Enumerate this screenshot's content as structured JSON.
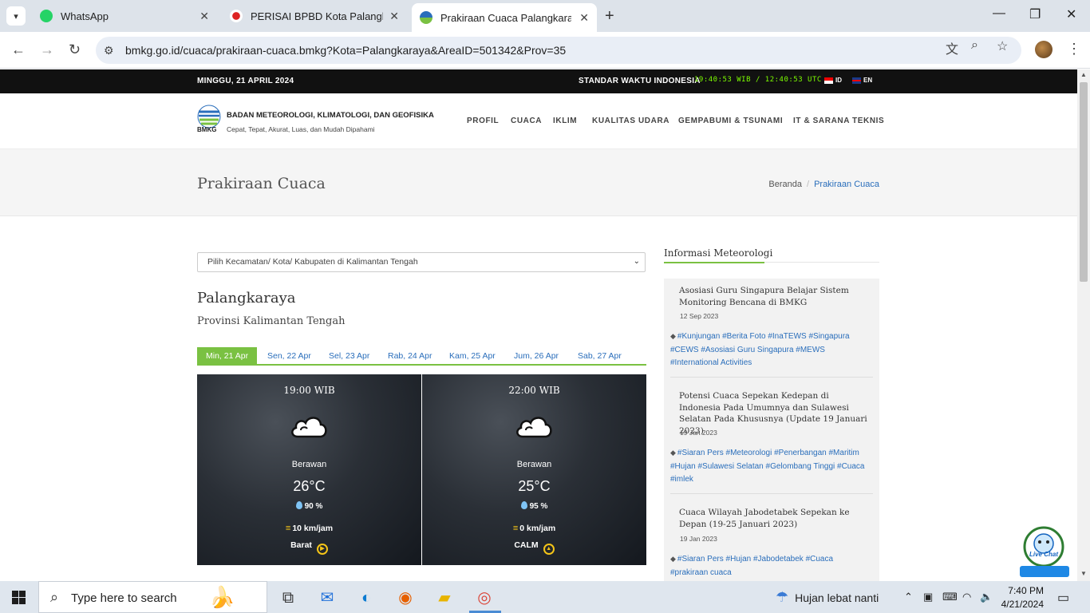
{
  "browser": {
    "tabs": [
      {
        "title": "WhatsApp"
      },
      {
        "title": "PERISAI BPBD Kota Palangka Ra"
      },
      {
        "title": "Prakiraan Cuaca Palangkaraya"
      }
    ],
    "url": "bmkg.go.id/cuaca/prakiraan-cuaca.bmkg?Kota=Palangkaraya&AreaID=501342&Prov=35"
  },
  "topbar": {
    "date": "MINGGU, 21 APRIL 2024",
    "standard_time_label": "STANDAR WAKTU INDONESIA",
    "clock": "19:40:53 WIB / 12:40:53 UTC",
    "lang_id": "ID",
    "lang_en": "EN"
  },
  "header": {
    "logo_text": "BMKG",
    "org_name": "BADAN METEOROLOGI, KLIMATOLOGI, DAN GEOFISIKA",
    "tagline": "Cepat, Tepat, Akurat, Luas, dan Mudah Dipahami",
    "menu": [
      "PROFIL",
      "CUACA",
      "IKLIM",
      "KUALITAS UDARA",
      "GEMPABUMI & TSUNAMI",
      "IT & SARANA TEKNIS"
    ]
  },
  "page": {
    "title": "Prakiraan Cuaca",
    "breadcrumb": [
      "Beranda",
      "Prakiraan Cuaca"
    ],
    "select_value": "Pilih Kecamatan/ Kota/ Kabupaten di Kalimantan Tengah",
    "city": "Palangkaraya",
    "province": "Provinsi Kalimantan Tengah",
    "day_tabs": [
      "Min, 21 Apr",
      "Sen, 22 Apr",
      "Sel, 23 Apr",
      "Rab, 24 Apr",
      "Kam, 25 Apr",
      "Jum, 26 Apr",
      "Sab, 27 Apr"
    ],
    "forecasts": [
      {
        "time": "19:00 WIB",
        "condition": "Berawan",
        "temp": "26°C",
        "humidity": "90 %",
        "wind": "10 km/jam",
        "direction": "Barat"
      },
      {
        "time": "22:00 WIB",
        "condition": "Berawan",
        "temp": "25°C",
        "humidity": "95 %",
        "wind": "0 km/jam",
        "direction": "CALM"
      }
    ]
  },
  "sidebar": {
    "heading": "Informasi Meteorologi",
    "news": [
      {
        "title": "Asosiasi Guru Singapura Belajar Sistem Monitoring Bencana di BMKG",
        "date": "12 Sep 2023",
        "tags": "#Kunjungan #Berita Foto #InaTEWS #Singapura #CEWS #Asosiasi Guru Singapura #MEWS #International Activities"
      },
      {
        "title": "Potensi Cuaca Sepekan Kedepan di Indonesia Pada Umumnya dan Sulawesi Selatan Pada Khususnya (Update 19 Januari 2023)",
        "date": "19 Jan 2023",
        "tags": "#Siaran Pers #Meteorologi #Penerbangan #Maritim #Hujan #Sulawesi Selatan #Gelombang Tinggi #Cuaca #imlek"
      },
      {
        "title": "Cuaca Wilayah Jabodetabek Sepekan ke Depan (19-25 Januari 2023)",
        "date": "19 Jan 2023",
        "tags": "#Siaran Pers #Hujan #Jabodetabek #Cuaca #prakiraan cuaca"
      }
    ],
    "livechat": "Live Chat"
  },
  "taskbar": {
    "search_placeholder": "Type here to search",
    "weather": "Hujan lebat nanti",
    "time": "7:40 PM",
    "date": "4/21/2024"
  }
}
